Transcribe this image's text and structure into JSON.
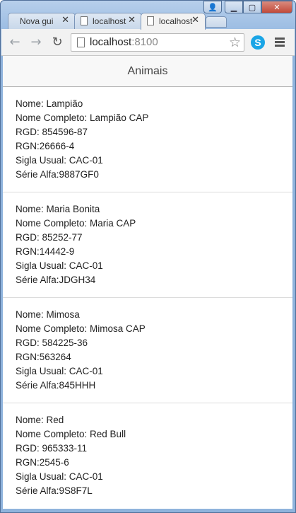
{
  "tabs": [
    {
      "label": "Nova guia",
      "active": false
    },
    {
      "label": "localhost",
      "active": false
    },
    {
      "label": "localhost",
      "active": true
    }
  ],
  "toolbar": {
    "url_host": "localhost",
    "url_port": ":8100"
  },
  "header": {
    "title": "Animais"
  },
  "animals": [
    {
      "nome": "Nome: Lampião",
      "nome_completo": "Nome Completo: Lampião CAP",
      "rgd": "RGD: 854596-87",
      "rgn": "RGN:26666-4",
      "sigla": "Sigla Usual: CAC-01",
      "serie": "Série Alfa:9887GF0"
    },
    {
      "nome": "Nome: Maria Bonita",
      "nome_completo": "Nome Completo: Maria CAP",
      "rgd": "RGD: 85252-77",
      "rgn": "RGN:14442-9",
      "sigla": "Sigla Usual: CAC-01",
      "serie": "Série Alfa:JDGH34"
    },
    {
      "nome": "Nome: Mimosa",
      "nome_completo": "Nome Completo: Mimosa CAP",
      "rgd": "RGD: 584225-36",
      "rgn": "RGN:563264",
      "sigla": "Sigla Usual: CAC-01",
      "serie": "Série Alfa:845HHH"
    },
    {
      "nome": "Nome: Red",
      "nome_completo": "Nome Completo: Red Bull",
      "rgd": "RGD: 965333-11",
      "rgn": "RGN:2545-6",
      "sigla": "Sigla Usual: CAC-01",
      "serie": "Série Alfa:9S8F7L"
    }
  ]
}
